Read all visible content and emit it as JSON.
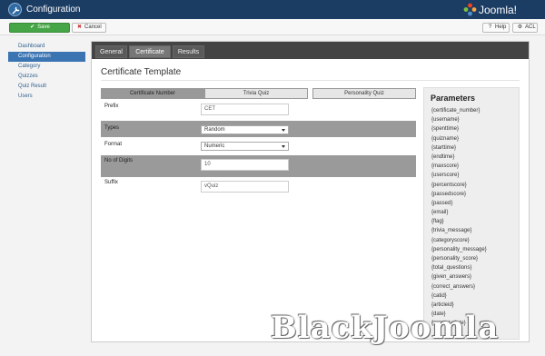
{
  "header": {
    "title": "Configuration",
    "brand": "Joomla!"
  },
  "toolbar": {
    "save_label": "Save",
    "cancel_label": "Cancel",
    "help_label": "Help",
    "acl_label": "ACL"
  },
  "sidebar": {
    "items": [
      {
        "label": "Dashboard"
      },
      {
        "label": "Configuration"
      },
      {
        "label": "Category"
      },
      {
        "label": "Quizzes"
      },
      {
        "label": "Quiz Result"
      },
      {
        "label": "Users"
      }
    ]
  },
  "tabs": [
    {
      "label": "General"
    },
    {
      "label": "Certificate"
    },
    {
      "label": "Results"
    }
  ],
  "main": {
    "title": "Certificate Template",
    "subtabs": [
      {
        "label": "Certificate Number"
      },
      {
        "label": "Trivia Quiz"
      },
      {
        "label": "Personality Quiz"
      }
    ],
    "form": {
      "prefix": {
        "label": "Prefix",
        "value": "CET"
      },
      "types": {
        "label": "Types",
        "value": "Random"
      },
      "format": {
        "label": "Format",
        "value": "Numeric"
      },
      "digits": {
        "label": "No of Digits",
        "value": "10"
      },
      "suffix": {
        "label": "Suffix",
        "value": "vQuiz"
      }
    }
  },
  "parameters": {
    "title": "Parameters",
    "items": [
      "{certificate_number}",
      "{username}",
      "{spenttime}",
      "{quizname}",
      "{starttime}",
      "{endtime}",
      "{maxscore}",
      "{userscore}",
      "{percentscore}",
      "{passedscore}",
      "{passed}",
      "{email}",
      "{flag}",
      "{trivia_message}",
      "{categoryscore}",
      "{personality_message}",
      "{personality_score}",
      "{total_questions}",
      "{given_answers}",
      "{correct_answers}",
      "{catid}",
      "{articleid}",
      "{date}",
      "{current_date}"
    ]
  },
  "watermark": "BlackJoomla",
  "colors": {
    "header_bg": "#1b3c63",
    "save_green": "#46a546",
    "sidebar_active": "#3b74b2",
    "row_gray": "#9a9a9a"
  }
}
